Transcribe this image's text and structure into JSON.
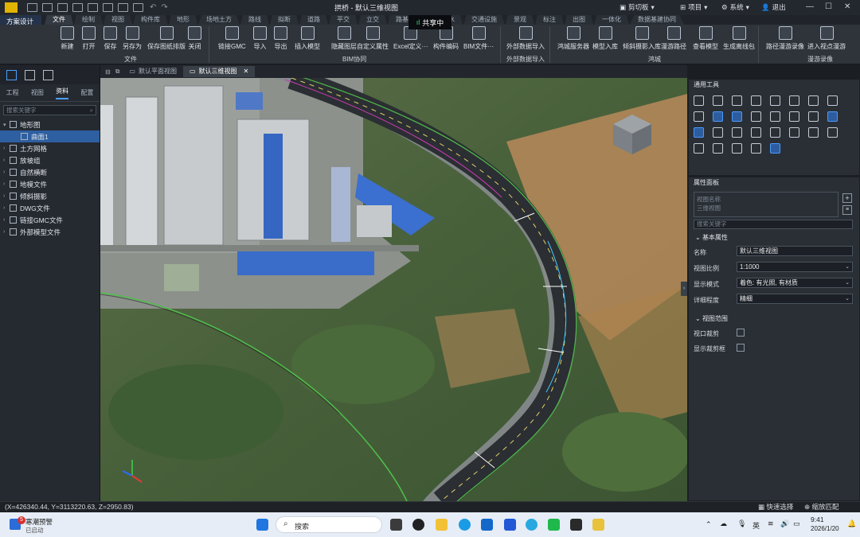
{
  "app": {
    "doc_title": "拱桥 - 默认三维视图",
    "project_menu": "项目",
    "system_menu": "系统",
    "logout": "退出",
    "clipboard": "剪切板"
  },
  "scheme": {
    "label": "方案设计"
  },
  "share": {
    "label": "共享中"
  },
  "ribbon_tabs": [
    "文件",
    "绘制",
    "视图",
    "构件库",
    "地形",
    "场地土方",
    "路线",
    "拟断",
    "道路",
    "平交",
    "立交",
    "路基",
    "",
    "排水",
    "交通设施",
    "景观",
    "标注",
    "出图",
    "一体化",
    "数据基建协同"
  ],
  "ribbon": {
    "file_group": {
      "title": "文件",
      "buttons": [
        "新建",
        "打开",
        "保存",
        "另存为",
        "保存图纸排版",
        "关闭"
      ]
    },
    "bim_group": {
      "title": "BIM协同",
      "buttons": [
        "链接GMC",
        "导入",
        "导出",
        "插入模型",
        "隐藏图层",
        "自定义属性",
        "Excel定义···",
        "构件编码",
        "BIM文件···"
      ]
    },
    "external_group": {
      "title": "外部数据导入",
      "buttons": [
        "外部数据导入"
      ]
    },
    "hongcheng_group": {
      "title": "鸿城",
      "buttons": [
        "鸿城服务器",
        "模型入库",
        "倾斜摄影入库",
        "漫游路径",
        "查看模型",
        "生成离线包"
      ]
    },
    "roam_group": {
      "title": "漫游录像",
      "buttons": [
        "路径漫游录像",
        "进入视点漫游"
      ]
    }
  },
  "left_panel": {
    "tabs": [
      "工程",
      "视图",
      "资料",
      "配置"
    ],
    "active_tab": "资料",
    "search_placeholder": "搜索关键字",
    "tree": [
      {
        "label": "地形图",
        "level": 0,
        "expanded": true
      },
      {
        "label": "曲面1",
        "level": 1,
        "selected": true
      },
      {
        "label": "土方网格",
        "level": 0
      },
      {
        "label": "放坡组",
        "level": 0
      },
      {
        "label": "自然横断",
        "level": 0
      },
      {
        "label": "地模文件",
        "level": 0
      },
      {
        "label": "倾斜摄影",
        "level": 0
      },
      {
        "label": "DWG文件",
        "level": 0
      },
      {
        "label": "链接GMC文件",
        "level": 0
      },
      {
        "label": "外部模型文件",
        "level": 0
      }
    ]
  },
  "doc_tabs": [
    "默认平面视图",
    "默认三维视图"
  ],
  "tools_panel": {
    "title": "通用工具"
  },
  "props": {
    "title": "属性面板",
    "view_placeholder_1": "视图名称",
    "view_placeholder_2": "三维视图",
    "search_placeholder": "搜索关键字",
    "basic_section": "基本属性",
    "rows": [
      {
        "label": "名称",
        "value": "默认三维视图"
      },
      {
        "label": "视图比例",
        "value": "1:1000"
      },
      {
        "label": "显示模式",
        "value": "着色: 有光照, 有材质"
      },
      {
        "label": "详细程度",
        "value": "精细"
      }
    ],
    "range_section": "视图范围",
    "crop_label": "视口裁剪",
    "crop_show_label": "显示裁剪框"
  },
  "status": {
    "coords": "(X=426340.44, Y=3113220.63, Z=2950.83)",
    "quick_select": "快速选择",
    "zoom_fit": "缩放匹配"
  },
  "taskbar": {
    "weather_title": "寒潮预警",
    "weather_sub": "已启动",
    "search": "搜索",
    "ime": "英",
    "time": "9:41",
    "date": "2026/1/20",
    "badge": "5"
  },
  "colors": {
    "accent": "#4aa0ff",
    "selected": "#2e5fa0",
    "panel": "#2a2f36"
  }
}
